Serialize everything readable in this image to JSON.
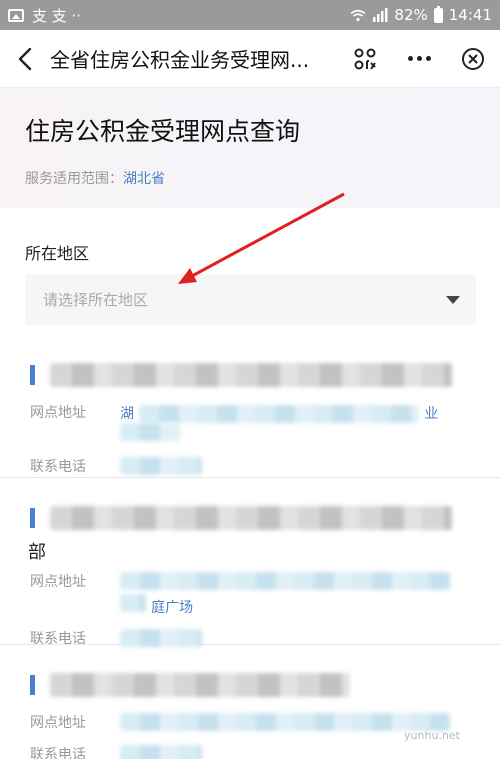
{
  "status": {
    "carrier_icons": "支 支 ··",
    "battery": "82%",
    "time": "14:41"
  },
  "nav": {
    "title": "全省住房公积金业务受理网...",
    "icons": [
      "back-arrow",
      "qr-scan",
      "more-dots",
      "close-circle"
    ]
  },
  "header": {
    "title": "住房公积金受理网点查询",
    "scope_label": "服务适用范围：",
    "scope_value": "湖北省"
  },
  "form": {
    "region_label": "所在地区",
    "region_placeholder": "请选择所在地区"
  },
  "list": {
    "cards": [
      {
        "address_label": "网点地址",
        "phone_label": "联系电话",
        "address_first": "湖",
        "address_last": "业",
        "name_extra": ""
      },
      {
        "address_label": "网点地址",
        "phone_label": "联系电话",
        "address_first": "",
        "address_last": "庭广场",
        "name_extra": "部"
      },
      {
        "address_label": "网点地址",
        "phone_label": "联系电话",
        "address_first": "",
        "address_last": "",
        "name_extra": ""
      }
    ]
  },
  "watermark": "yunhu.net",
  "colors": {
    "accent": "#4a7fc5",
    "bar": "#4a7fd0",
    "annotation": "#e02020"
  }
}
